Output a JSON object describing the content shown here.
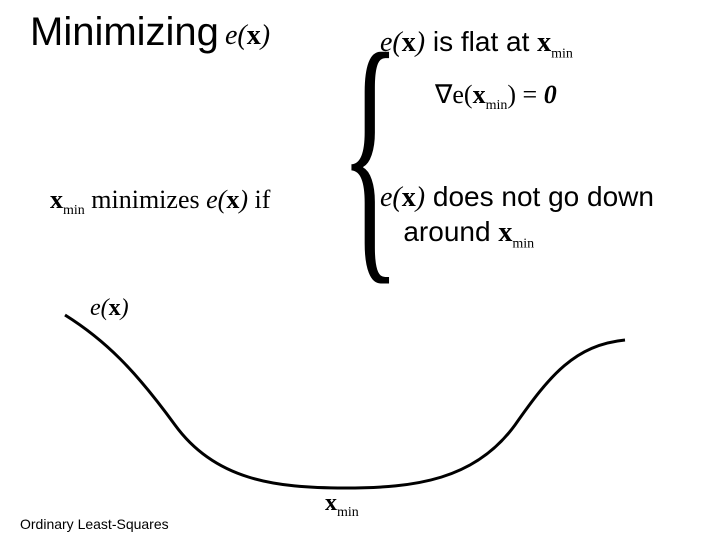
{
  "title": "Minimizing",
  "e_of_x": "e(x)",
  "flat_text": "is flat at",
  "xmin_label": "x",
  "xmin_sub": "min",
  "grad_expr_left": "∇e(",
  "grad_expr_mid_var": "x",
  "grad_expr_mid_sub": "min",
  "grad_expr_right": ") = ",
  "grad_zero": "0",
  "down_text_1": "does not go down",
  "down_text_2": "around",
  "min_cond_pre_var": "x",
  "min_cond_pre_sub": "min",
  "min_cond_mid": " minimizes ",
  "min_cond_expr": "e(x)",
  "min_cond_tail": " if",
  "axis_e_label": "e(x)",
  "axis_xmin_var": "x",
  "axis_xmin_sub": "min",
  "footer": "Ordinary Least-Squares"
}
